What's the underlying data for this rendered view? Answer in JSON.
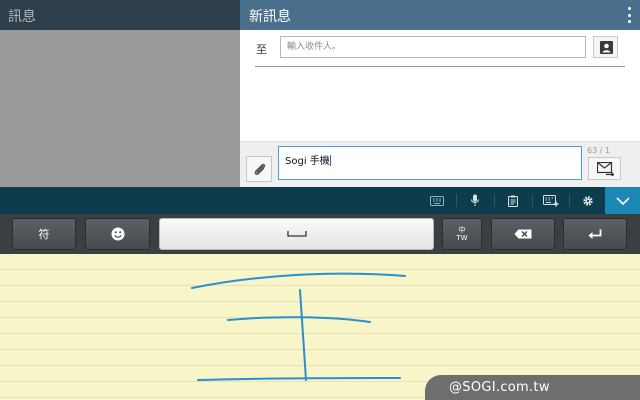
{
  "left_pane": {
    "title": "訊息"
  },
  "compose": {
    "title": "新訊息",
    "to_label": "至",
    "recipient_placeholder": "輸入收件人。",
    "message_text": "Sogi 手機",
    "char_count": "63 / 1"
  },
  "keyboard": {
    "toolbar_icons": [
      "keyboard-icon",
      "microphone-icon",
      "clipboard-icon",
      "keyboard-settings-icon",
      "gear-icon",
      "chevron-down-icon"
    ],
    "row_switch_label": "符",
    "lang_label_top": "中",
    "lang_label_bottom": "TW",
    "handwriting_character": "王"
  },
  "watermark": "@SOGI.com.tw",
  "colors": {
    "header_left": "#2f3e4b",
    "header_right": "#4a6f8c",
    "toolbar": "#0d3d4d",
    "toolbar_accent": "#1b87b4",
    "input_focus": "#4aa0d4",
    "handwriting_ink": "#2a8fd0",
    "pad_paper": "#f8f5c8"
  }
}
